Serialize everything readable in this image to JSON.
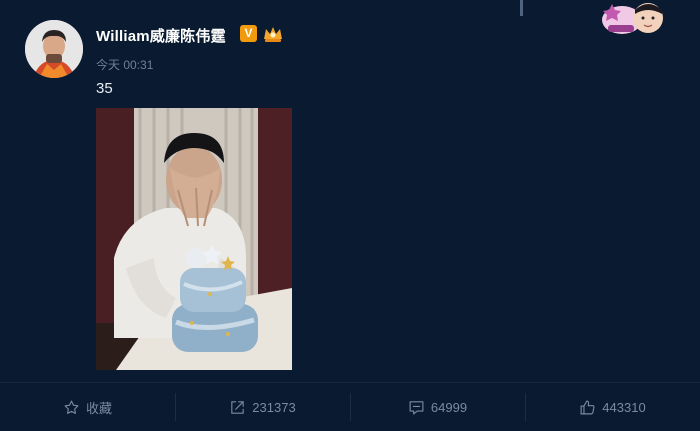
{
  "post": {
    "username": "William威廉陈伟霆",
    "verified_badge": "V",
    "timestamp": "今天 00:31",
    "text": "35"
  },
  "actions": {
    "favorite_label": "收藏",
    "repost_count": "231373",
    "comment_count": "64999",
    "like_count": "443310"
  },
  "colors": {
    "background": "#0a1a30",
    "accent": "#f29a0e",
    "muted_text": "#7b8aa1"
  },
  "icons": [
    "star-icon",
    "share-icon",
    "comment-icon",
    "thumbs-up-icon",
    "vip-crown-icon"
  ]
}
